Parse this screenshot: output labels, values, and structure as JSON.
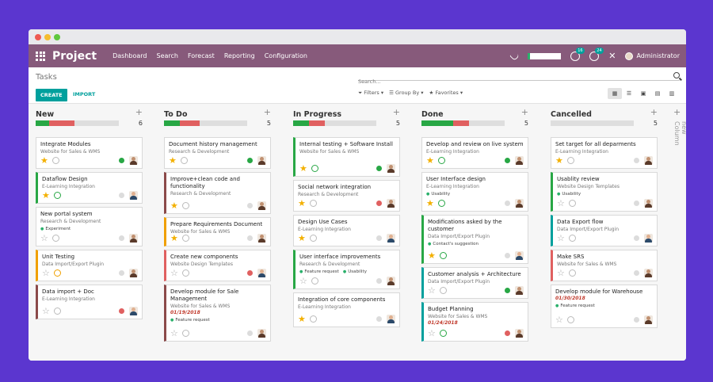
{
  "nav": {
    "brand": "Project",
    "menu": [
      "Dashboard",
      "Search",
      "Forecast",
      "Reporting",
      "Configuration"
    ],
    "badge_activity": "16",
    "badge_messages": "24",
    "user": "Administrator"
  },
  "control": {
    "breadcrumb": "Tasks",
    "create": "CREATE",
    "import": "IMPORT",
    "search_placeholder": "Search...",
    "filters": "Filters",
    "group_by": "Group By",
    "favorites": "Favorites"
  },
  "colors": {
    "navbar": "#875a7b",
    "accent": "#00a09d",
    "green": "#28a745",
    "red": "#e06060",
    "star": "#f3b000"
  },
  "add_column": "Add new Column",
  "columns": [
    {
      "title": "New",
      "count": "6",
      "progress_green": 0.16,
      "progress_red": 0.31,
      "cards": [
        {
          "title": "Integrate Modules",
          "sub": "Website for Sales & WMS",
          "star": true,
          "clock": "grey",
          "state": "green",
          "avatar": 1
        },
        {
          "title": "Dataflow Design",
          "sub": "E-Learning Integration",
          "star": true,
          "clock": "green",
          "state": "grey",
          "avatar": 0,
          "border": "green"
        },
        {
          "title": "New portal system",
          "sub": "Research & Development",
          "tags": [
            "Experiment"
          ],
          "star": false,
          "clock": "grey",
          "state": "grey",
          "avatar": 1
        },
        {
          "title": "Unit Testing",
          "sub": "Data Import/Export Plugin",
          "star": false,
          "clock": "orange",
          "state": "grey",
          "avatar": 1,
          "border": "orange"
        },
        {
          "title": "Data import + Doc",
          "sub": "E-Learning Integration",
          "star": false,
          "clock": "grey",
          "state": "red",
          "avatar": 0,
          "border": "brown"
        }
      ]
    },
    {
      "title": "To Do",
      "count": "5",
      "progress_green": 0.19,
      "progress_red": 0.24,
      "cards": [
        {
          "title": "Document history management",
          "sub": "Research & Development",
          "star": true,
          "clock": "grey",
          "state": "green",
          "avatar": 1
        },
        {
          "title": "Improve+clean code and functionality",
          "sub": "Research & Development",
          "star": true,
          "clock": "grey",
          "state": "grey",
          "avatar": 1,
          "border": "brown"
        },
        {
          "title": "Prepare Requirements Document",
          "sub": "Website for Sales & WMS",
          "star": true,
          "clock": "grey",
          "state": "grey",
          "avatar": 1,
          "border": "orange"
        },
        {
          "title": "Create new components",
          "sub": "Website Design Templates",
          "star": false,
          "clock": "grey",
          "state": "red",
          "avatar": 0,
          "border": "red"
        },
        {
          "title": "Develop module for Sale Management",
          "sub": "Website for Sales & WMS",
          "date": "01/19/2018",
          "tags": [
            "Feature request"
          ],
          "star": false,
          "clock": "grey",
          "state": "grey",
          "avatar": 1,
          "border": "brown"
        }
      ]
    },
    {
      "title": "In Progress",
      "count": "5",
      "progress_green": 0.19,
      "progress_red": 0.19,
      "cards": [
        {
          "title": "Internal testing + Software Install",
          "sub": "Website for Sales & WMS",
          "star": true,
          "clock": "green",
          "state": "green",
          "avatar": 1,
          "border": "green"
        },
        {
          "title": "Social network integration",
          "sub": "Research & Development",
          "star": true,
          "clock": "grey",
          "state": "red",
          "avatar": 1
        },
        {
          "title": "Design Use Cases",
          "sub": "E-Learning Integration",
          "star": true,
          "clock": "grey",
          "state": "grey",
          "avatar": 0
        },
        {
          "title": "User interface improvements",
          "sub": "Research & Development",
          "tags": [
            "Feature request",
            "Usability"
          ],
          "star": false,
          "clock": "grey",
          "state": "grey",
          "avatar": 1,
          "border": "green"
        },
        {
          "title": "Integration of core components",
          "sub": "E-Learning Integration",
          "star": true,
          "clock": "grey",
          "state": "grey",
          "avatar": 0
        }
      ]
    },
    {
      "title": "Done",
      "count": "5",
      "progress_green": 0.38,
      "progress_red": 0.19,
      "cards": [
        {
          "title": "Develop and review on live system",
          "sub": "E-Learning Integration",
          "star": true,
          "clock": "green",
          "state": "green",
          "avatar": 1
        },
        {
          "title": "User Interface design",
          "sub": "E-Learning Integration",
          "tags": [
            "Usability"
          ],
          "star": true,
          "clock": "green",
          "state": "grey",
          "avatar": 1
        },
        {
          "title": "Modifications asked by the customer",
          "sub": "Data Import/Export Plugin",
          "tags": [
            "Contact's suggestion"
          ],
          "star": true,
          "clock": "green",
          "state": "grey",
          "avatar": 0,
          "border": "green"
        },
        {
          "title": "Customer analysis + Architecture",
          "sub": "Data Import/Export Plugin",
          "star": false,
          "clock": "grey",
          "state": "green",
          "avatar": 1,
          "border": "teal"
        },
        {
          "title": "Budget Planning",
          "sub": "Website for Sales & WMS",
          "date": "01/24/2018",
          "star": false,
          "clock": "green",
          "state": "red",
          "avatar": 1,
          "border": "teal"
        }
      ]
    },
    {
      "title": "Cancelled",
      "count": "5",
      "progress_green": 0,
      "progress_red": 0,
      "cards": [
        {
          "title": "Set target for all deparments",
          "sub": "E-Learning Integration",
          "star": true,
          "clock": "grey",
          "state": "grey",
          "avatar": 1
        },
        {
          "title": "Usablity review",
          "sub": "Website Design Templates",
          "tags": [
            "Usability"
          ],
          "star": false,
          "clock": "grey",
          "state": "grey",
          "avatar": 1,
          "border": "green"
        },
        {
          "title": "Data Export flow",
          "sub": "Data Import/Export Plugin",
          "star": false,
          "clock": "grey",
          "state": "grey",
          "avatar": 0,
          "border": "teal"
        },
        {
          "title": "Make SRS",
          "sub": "Website for Sales & WMS",
          "star": false,
          "clock": "grey",
          "state": "grey",
          "avatar": 1,
          "border": "red"
        },
        {
          "title": "Develop module for Warehouse",
          "sub": "",
          "date": "01/30/2018",
          "tags": [
            "Feature request"
          ],
          "star": false,
          "clock": "grey",
          "state": "grey",
          "avatar": 1
        }
      ]
    }
  ]
}
